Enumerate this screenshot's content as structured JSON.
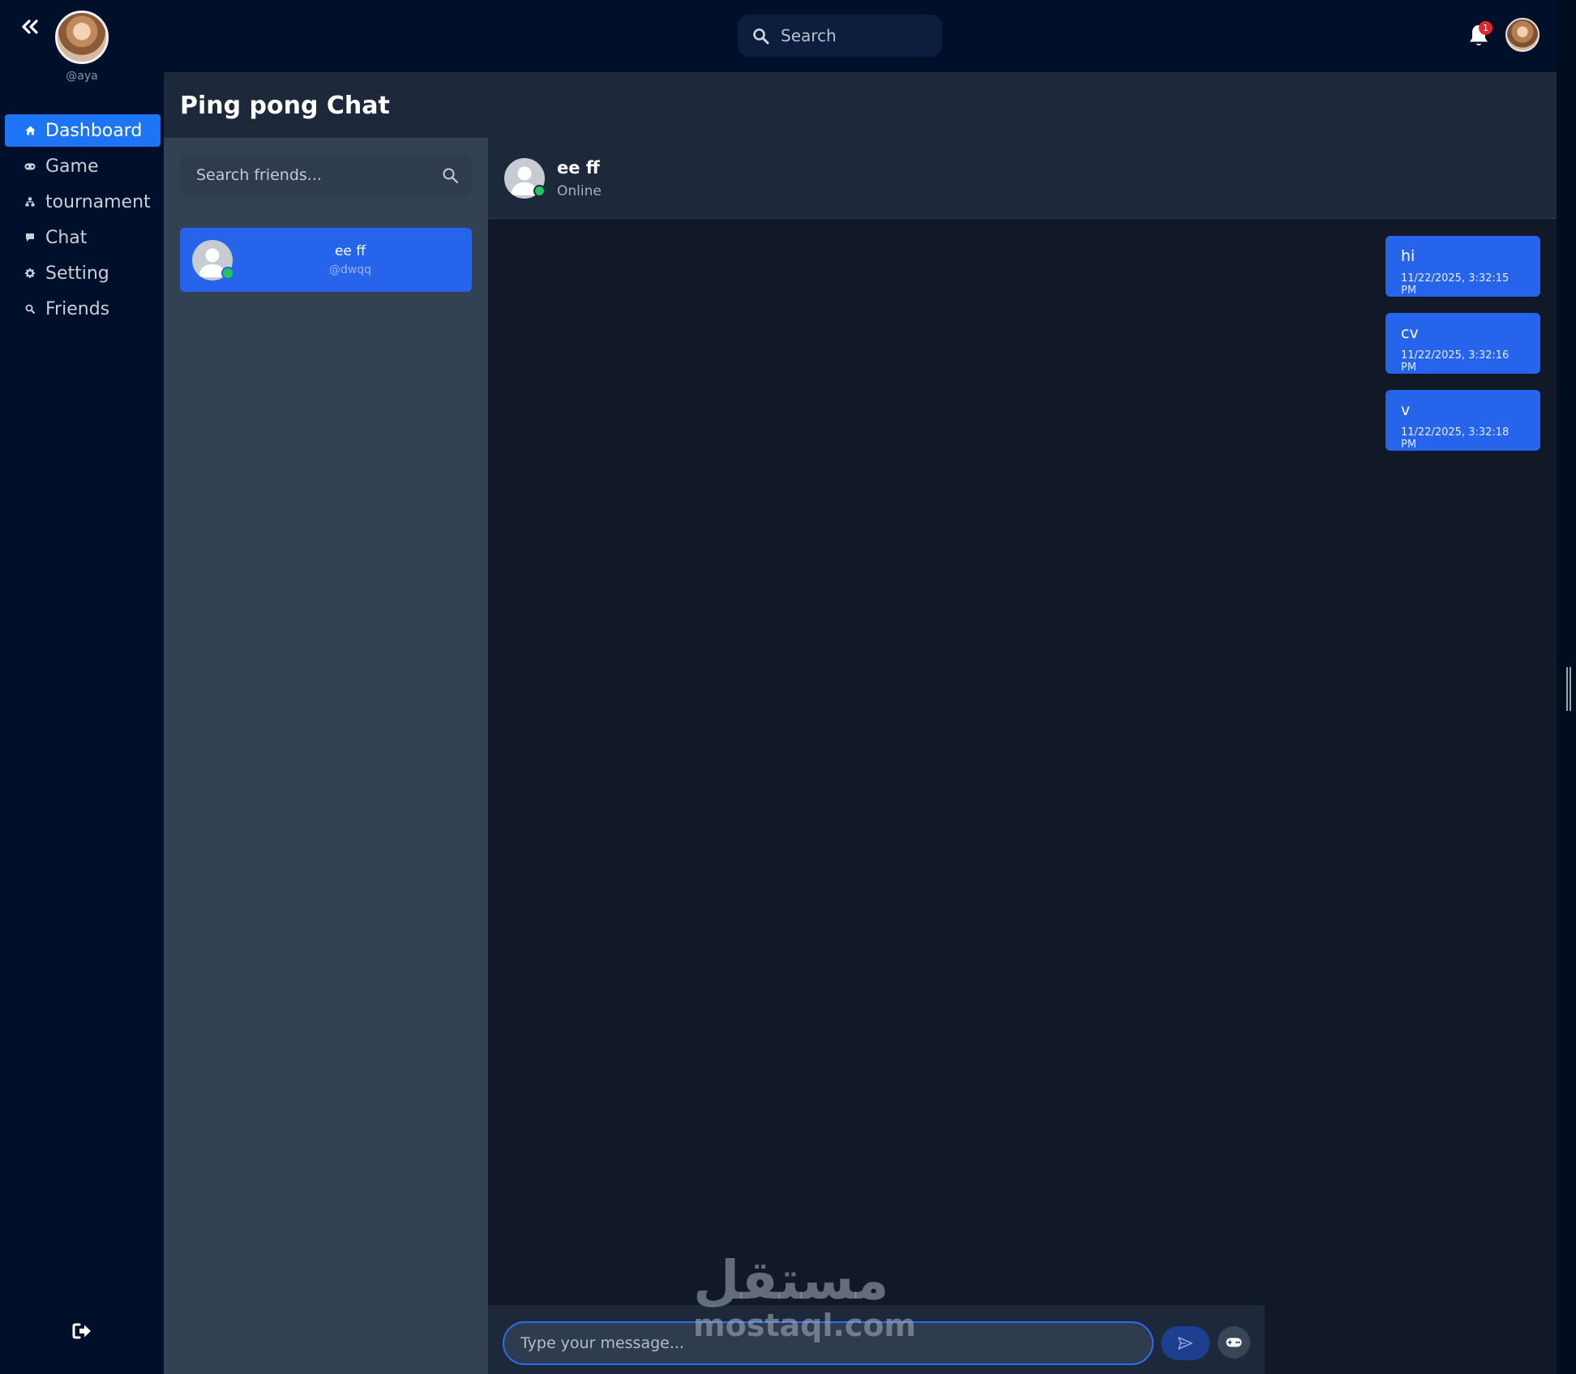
{
  "user": {
    "handle": "@aya"
  },
  "sidebar": {
    "items": [
      {
        "label": "Dashboard",
        "icon": "home-icon",
        "active": true
      },
      {
        "label": "Game",
        "icon": "gamepad-icon",
        "active": false
      },
      {
        "label": "tournament",
        "icon": "tournament-icon",
        "active": false
      },
      {
        "label": "Chat",
        "icon": "chat-icon",
        "active": false
      },
      {
        "label": "Setting",
        "icon": "gear-icon",
        "active": false
      },
      {
        "label": "Friends",
        "icon": "search-icon",
        "active": false
      }
    ]
  },
  "topbar": {
    "search_placeholder": "Search",
    "notification_count": "1"
  },
  "page": {
    "title": "Ping pong Chat"
  },
  "friends": {
    "search_placeholder": "Search friends...",
    "list": [
      {
        "name": "ee ff",
        "handle": "@dwqq",
        "online": true
      }
    ]
  },
  "chat": {
    "contact_name": "ee ff",
    "contact_status": "Online",
    "messages": [
      {
        "text": "hi",
        "time": "11/22/2025, 3:32:15 PM"
      },
      {
        "text": "cv",
        "time": "11/22/2025, 3:32:16 PM"
      },
      {
        "text": "v",
        "time": "11/22/2025, 3:32:18 PM"
      }
    ],
    "input_placeholder": "Type your message..."
  },
  "watermark": {
    "arabic": "مستقل",
    "latin": "mostaql.com"
  },
  "colors": {
    "accent": "#2564eb",
    "nav_active": "#1d74f5",
    "online": "#22c55e",
    "badge": "#e5262b",
    "sidebar_bg": "#01102a",
    "main_bg": "#1d283a",
    "chat_bg": "#111827"
  }
}
